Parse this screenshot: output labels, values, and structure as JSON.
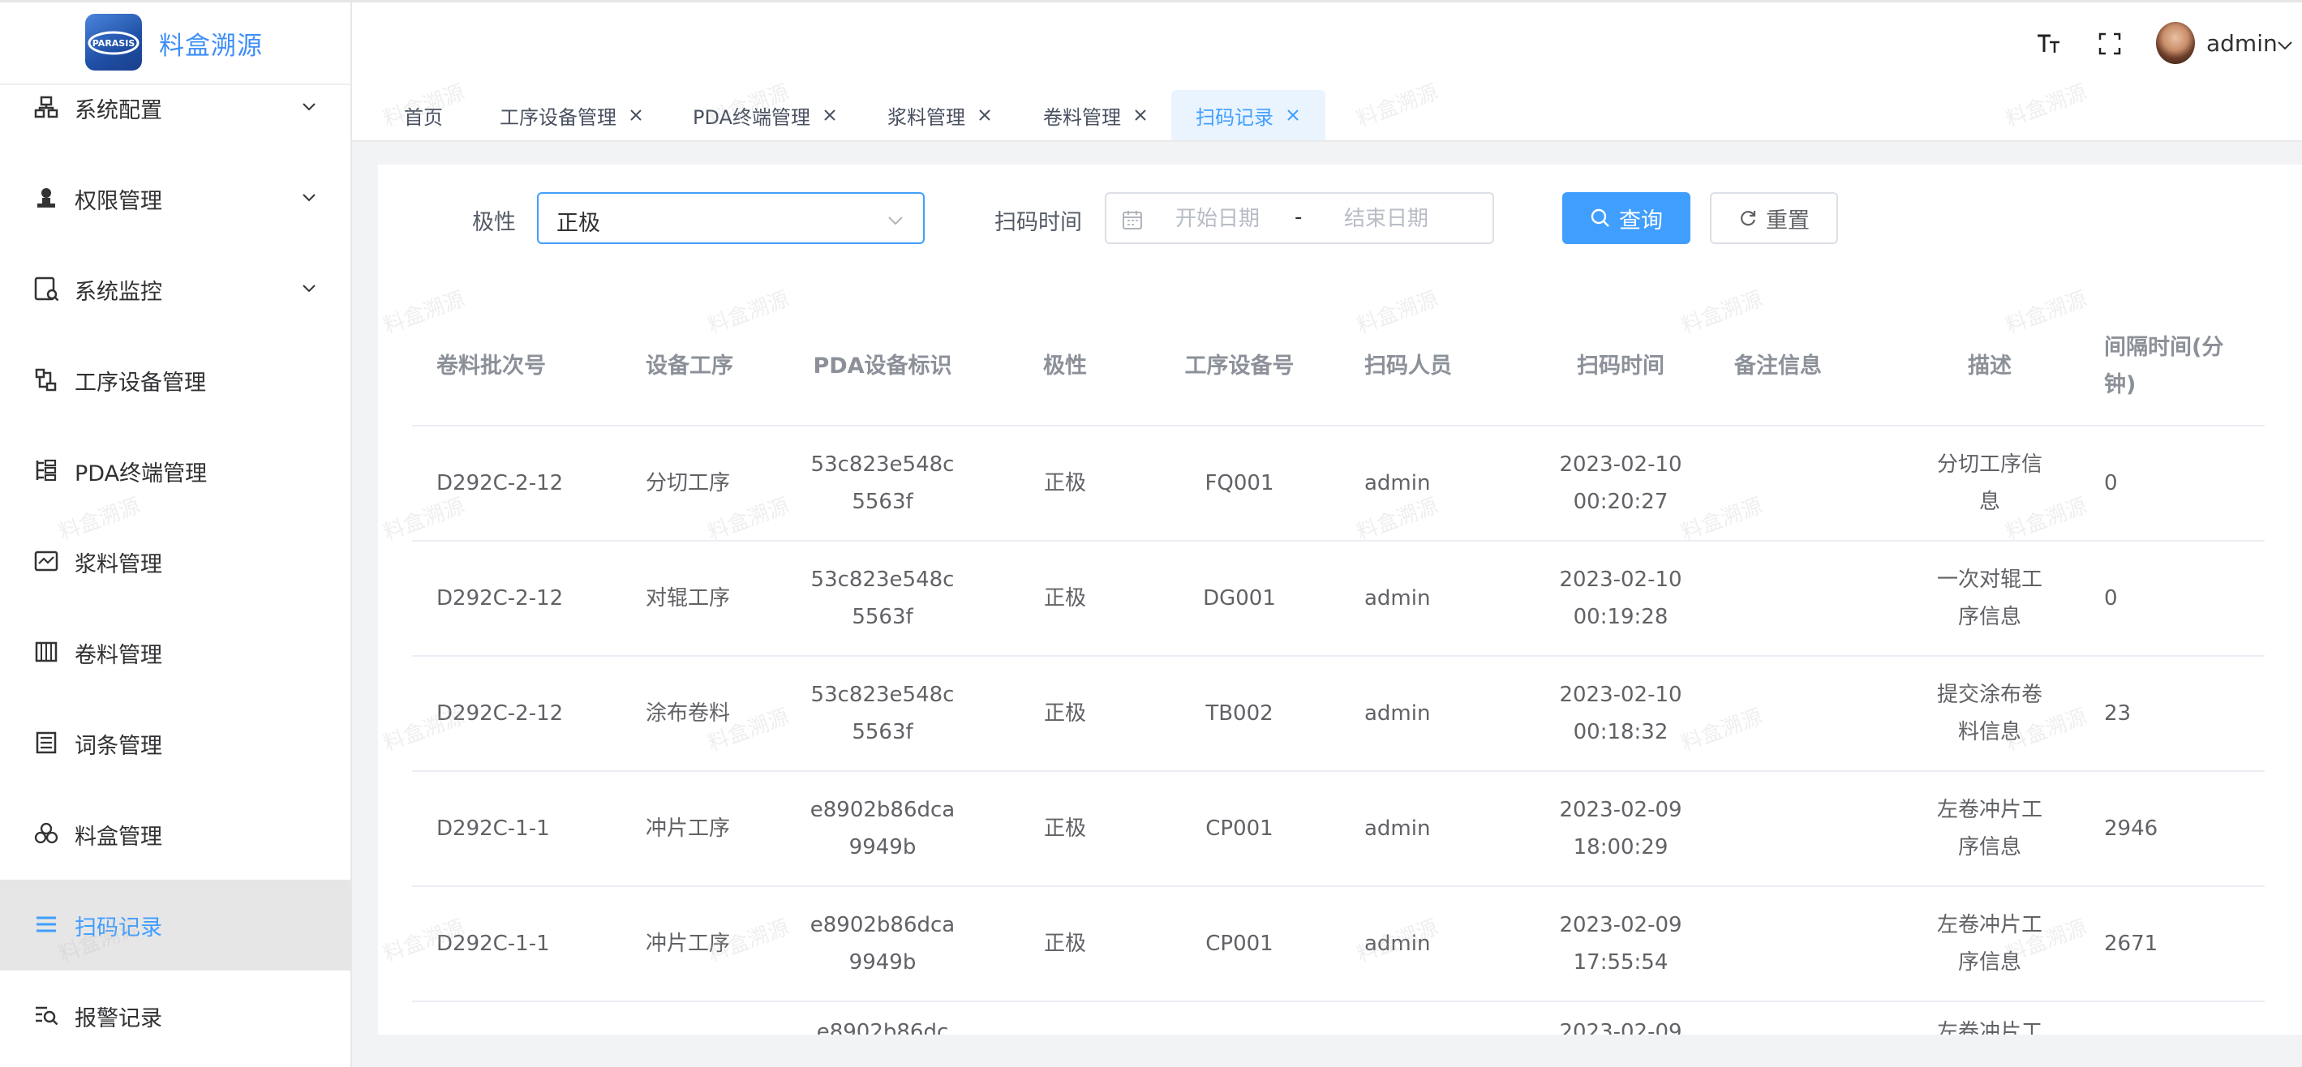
{
  "app": {
    "title": "料盒溯源",
    "logo_text": "PARASIS"
  },
  "sidebar": {
    "items": [
      {
        "label": "系统配置",
        "icon": "system-config-icon",
        "has_arrow": true
      },
      {
        "label": "权限管理",
        "icon": "permission-icon",
        "has_arrow": true
      },
      {
        "label": "系统监控",
        "icon": "monitor-icon",
        "has_arrow": true
      },
      {
        "label": "工序设备管理",
        "icon": "process-device-icon",
        "has_arrow": false
      },
      {
        "label": "PDA终端管理",
        "icon": "pda-icon",
        "has_arrow": false
      },
      {
        "label": "浆料管理",
        "icon": "slurry-icon",
        "has_arrow": false
      },
      {
        "label": "卷料管理",
        "icon": "roll-icon",
        "has_arrow": false
      },
      {
        "label": "词条管理",
        "icon": "dictionary-icon",
        "has_arrow": false
      },
      {
        "label": "料盒管理",
        "icon": "box-icon",
        "has_arrow": false
      },
      {
        "label": "扫码记录",
        "icon": "scan-record-icon",
        "has_arrow": false,
        "active": true
      },
      {
        "label": "报警记录",
        "icon": "alarm-record-icon",
        "has_arrow": false
      }
    ]
  },
  "header": {
    "user": "admin"
  },
  "tags": [
    {
      "label": "首页",
      "closable": false
    },
    {
      "label": "工序设备管理",
      "closable": true
    },
    {
      "label": "PDA终端管理",
      "closable": true
    },
    {
      "label": "浆料管理",
      "closable": true
    },
    {
      "label": "卷料管理",
      "closable": true
    },
    {
      "label": "扫码记录",
      "closable": true,
      "active": true
    }
  ],
  "filter": {
    "polarity_label": "极性",
    "polarity_value": "正极",
    "scan_time_label": "扫码时间",
    "start_placeholder": "开始日期",
    "range_separator": "-",
    "end_placeholder": "结束日期",
    "query_label": "查询",
    "reset_label": "重置"
  },
  "table": {
    "columns": [
      {
        "key": "batch",
        "label": "卷料批次号"
      },
      {
        "key": "process",
        "label": "设备工序"
      },
      {
        "key": "pda",
        "label": "PDA设备标识"
      },
      {
        "key": "polarity",
        "label": "极性"
      },
      {
        "key": "device",
        "label": "工序设备号"
      },
      {
        "key": "operator",
        "label": "扫码人员"
      },
      {
        "key": "time",
        "label": "扫码时间"
      },
      {
        "key": "remark",
        "label": "备注信息"
      },
      {
        "key": "desc",
        "label": "描述"
      },
      {
        "key": "interval",
        "label": "间隔时间(分钟)"
      }
    ],
    "rows": [
      {
        "batch": "D292C-2-12",
        "process": "分切工序",
        "pda": "53c823e548c5563f",
        "polarity": "正极",
        "device": "FQ001",
        "operator": "admin",
        "time": "2023-02-10 00:20:27",
        "remark": "",
        "desc": "分切工序信息",
        "interval": "0"
      },
      {
        "batch": "D292C-2-12",
        "process": "对辊工序",
        "pda": "53c823e548c5563f",
        "polarity": "正极",
        "device": "DG001",
        "operator": "admin",
        "time": "2023-02-10 00:19:28",
        "remark": "",
        "desc": "一次对辊工序信息",
        "interval": "0"
      },
      {
        "batch": "D292C-2-12",
        "process": "涂布卷料",
        "pda": "53c823e548c5563f",
        "polarity": "正极",
        "device": "TB002",
        "operator": "admin",
        "time": "2023-02-10 00:18:32",
        "remark": "",
        "desc": "提交涂布卷料信息",
        "interval": "23"
      },
      {
        "batch": "D292C-1-1",
        "process": "冲片工序",
        "pda": "e8902b86dca9949b",
        "polarity": "正极",
        "device": "CP001",
        "operator": "admin",
        "time": "2023-02-09 18:00:29",
        "remark": "",
        "desc": "左卷冲片工序信息",
        "interval": "2946"
      },
      {
        "batch": "D292C-1-1",
        "process": "冲片工序",
        "pda": "e8902b86dca9949b",
        "polarity": "正极",
        "device": "CP001",
        "operator": "admin",
        "time": "2023-02-09 17:55:54",
        "remark": "",
        "desc": "左卷冲片工序信息",
        "interval": "2671"
      }
    ],
    "partial_row": {
      "pda": "e8902b86dc",
      "time": "2023-02-09",
      "desc": "左卷冲片工"
    }
  },
  "watermark": "料盒溯源"
}
